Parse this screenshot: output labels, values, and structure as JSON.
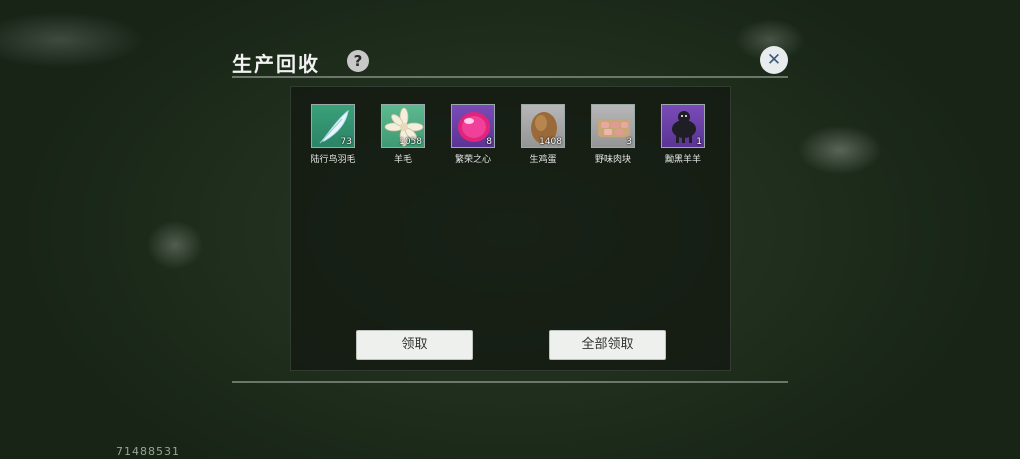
{
  "header": {
    "title": "生产回收",
    "help_icon": "?",
    "close_icon": "✕"
  },
  "items": [
    {
      "name": "陆行鸟羽毛",
      "count": "73",
      "icon": "feather-icon"
    },
    {
      "name": "羊毛",
      "count": "1058",
      "icon": "wool-icon"
    },
    {
      "name": "繁荣之心",
      "count": "8",
      "icon": "pink-gem-icon"
    },
    {
      "name": "生鸡蛋",
      "count": "1408",
      "icon": "egg-icon"
    },
    {
      "name": "野味肉块",
      "count": "3",
      "icon": "meat-icon"
    },
    {
      "name": "黝黑羊羊",
      "count": "1",
      "icon": "black-sheep-icon"
    }
  ],
  "actions": {
    "claim": "领取",
    "claim_all": "全部领取"
  },
  "footer": {
    "uid": "71488531"
  }
}
